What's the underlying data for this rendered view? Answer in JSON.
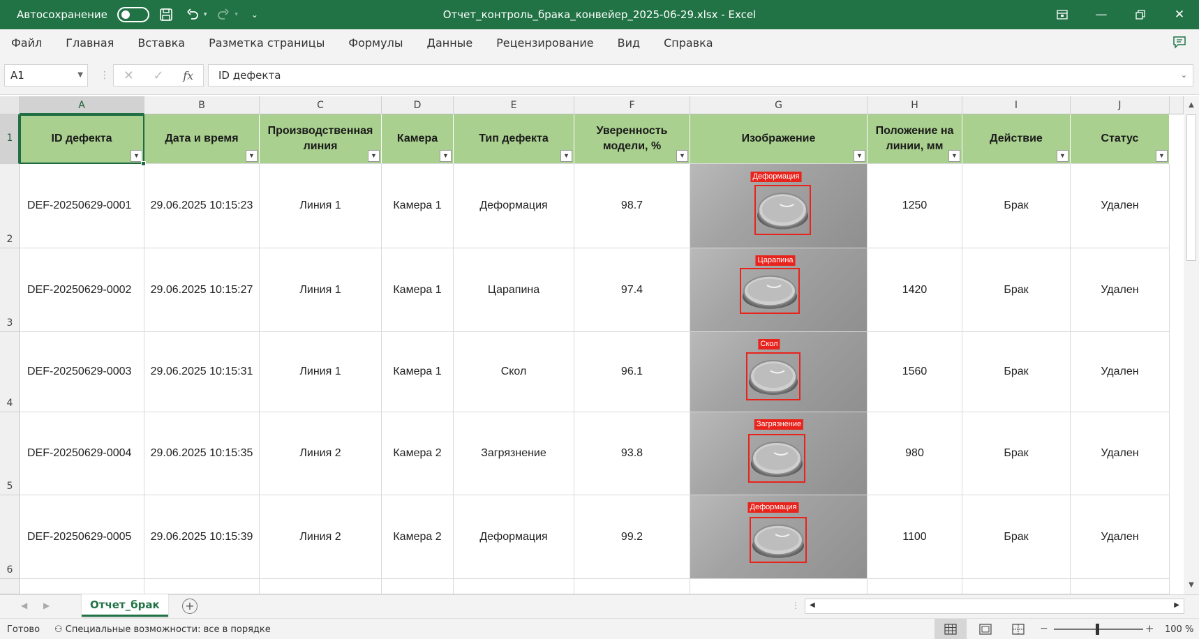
{
  "titlebar": {
    "autosave_label": "Автосохранение",
    "title": "Отчет_контроль_брака_конвейер_2025-06-29.xlsx  -  Excel"
  },
  "menu": [
    "Файл",
    "Главная",
    "Вставка",
    "Разметка страницы",
    "Формулы",
    "Данные",
    "Рецензирование",
    "Вид",
    "Справка"
  ],
  "formula_bar": {
    "name_box": "A1",
    "formula": "ID дефекта"
  },
  "columns": [
    "A",
    "B",
    "C",
    "D",
    "E",
    "F",
    "G",
    "H",
    "I",
    "J"
  ],
  "row_numbers": [
    "1",
    "2",
    "3",
    "4",
    "5",
    "6"
  ],
  "headers": [
    "ID дефекта",
    "Дата и время",
    "Производственная линия",
    "Камера",
    "Тип дефекта",
    "Уверенность модели, %",
    "Изображение",
    "Положение на линии, мм",
    "Действие",
    "Статус"
  ],
  "rows": [
    {
      "id": "DEF-20250629-0001",
      "datetime": "29.06.2025 10:15:23",
      "line": "Линия 1",
      "camera": "Камера 1",
      "type": "Деформация",
      "confidence": "98.7",
      "image_label": "Деформация",
      "position": "1250",
      "action": "Брак",
      "status": "Удален"
    },
    {
      "id": "DEF-20250629-0002",
      "datetime": "29.06.2025 10:15:27",
      "line": "Линия 1",
      "camera": "Камера 1",
      "type": "Царапина",
      "confidence": "97.4",
      "image_label": "Царапина",
      "position": "1420",
      "action": "Брак",
      "status": "Удален"
    },
    {
      "id": "DEF-20250629-0003",
      "datetime": "29.06.2025 10:15:31",
      "line": "Линия 1",
      "camera": "Камера 1",
      "type": "Скол",
      "confidence": "96.1",
      "image_label": "Скол",
      "position": "1560",
      "action": "Брак",
      "status": "Удален"
    },
    {
      "id": "DEF-20250629-0004",
      "datetime": "29.06.2025 10:15:35",
      "line": "Линия 2",
      "camera": "Камера 2",
      "type": "Загрязнение",
      "confidence": "93.8",
      "image_label": "Загрязнение",
      "position": "980",
      "action": "Брак",
      "status": "Удален"
    },
    {
      "id": "DEF-20250629-0005",
      "datetime": "29.06.2025 10:15:39",
      "line": "Линия 2",
      "camera": "Камера 2",
      "type": "Деформация",
      "confidence": "99.2",
      "image_label": "Деформация",
      "position": "1100",
      "action": "Брак",
      "status": "Удален"
    }
  ],
  "sheet_tab": "Отчет_брак",
  "status": {
    "ready": "Готово",
    "accessibility": "Специальные возможности: все в порядке",
    "zoom": "100 %"
  },
  "colors": {
    "brand": "#217346",
    "header_fill": "#a9d08e",
    "detection": "#e8231c"
  }
}
